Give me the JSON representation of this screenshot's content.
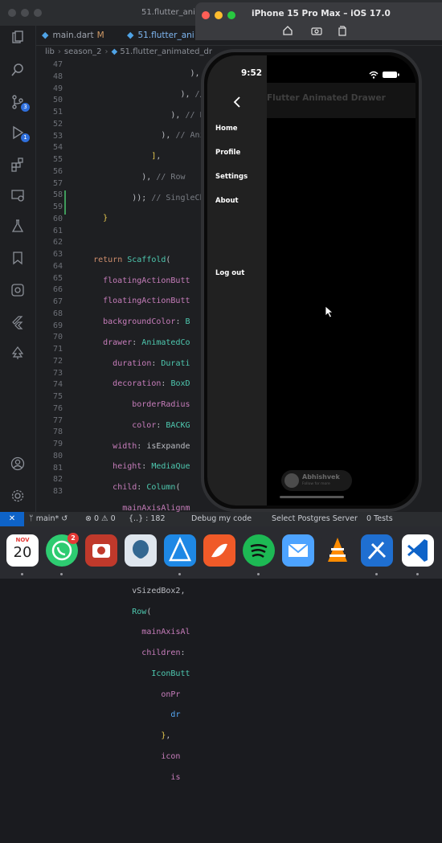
{
  "vscode": {
    "window_title": "51.flutter_anim",
    "tabs": [
      {
        "name": "main.dart",
        "modifier": "M"
      },
      {
        "name": "51.flutter_ani",
        "modifier": ""
      }
    ],
    "breadcrumb": [
      "lib",
      "season_2",
      "51.flutter_animated_dr"
    ],
    "line_numbers": [
      "47",
      "48",
      "49",
      "50",
      "51",
      "52",
      "53",
      "54",
      "55",
      "56",
      "57",
      "58",
      "59",
      "60",
      "61",
      "62",
      "63",
      "64",
      "65",
      "66",
      "67",
      "68",
      "69",
      "70",
      "71",
      "72",
      "73",
      "74",
      "75",
      "76",
      "77",
      "78",
      "79",
      "80",
      "81",
      "82",
      "83"
    ],
    "activity_badges": {
      "source_control": "3",
      "run_debug": "1"
    },
    "status": {
      "branch": "main*",
      "problems": "⊗ 0 ⚠ 0",
      "position": "{..} : 182",
      "debug": "Debug my code",
      "postgres": "Select Postgres Server",
      "tests": "0 Tests"
    }
  },
  "simulator": {
    "title": "iPhone 15 Pro Max – iOS 17.0",
    "status_time": "9:52",
    "app_title": "Flutter Animated Drawer",
    "drawer_items": [
      {
        "label": "Home"
      },
      {
        "label": "Profile"
      },
      {
        "label": "Settings"
      },
      {
        "label": "About"
      }
    ],
    "logout_label": "Log out",
    "watermark_name": "Abhishvek",
    "watermark_sub": "Follow for more"
  },
  "dock": {
    "calendar_month": "NOV",
    "calendar_day": "20",
    "whatsapp_badge": "2",
    "apps": [
      "calendar",
      "whatsapp",
      "photo-booth",
      "postgres",
      "instruments",
      "swift",
      "spotify",
      "mail",
      "vlc",
      "xcode",
      "vscode"
    ]
  },
  "colors": {
    "accent": "#0e63c8",
    "editor_bg": "#1e1f22",
    "drawer_bg": "#212121",
    "badge_red": "#e53935"
  }
}
